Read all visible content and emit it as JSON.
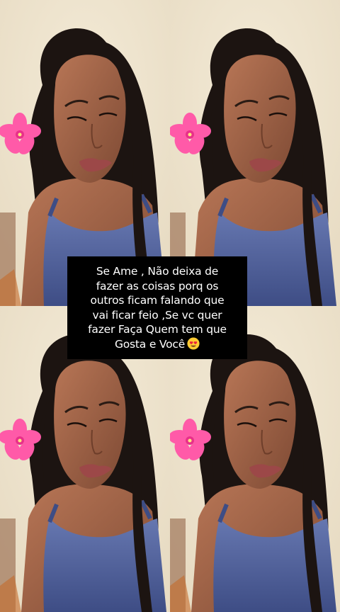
{
  "caption": {
    "lines": [
      "Se Ame , Não deixa de",
      "fazer as coisas porq os",
      "outros ficam falando que",
      "vai ficar feio ,Se vc quer",
      "fazer Faça Quem tem que",
      "Gosta e Você"
    ],
    "emoji": "heart-eyes-emoji"
  },
  "photo": {
    "tiles": 4,
    "description_icon": "selfie-photo",
    "colors": {
      "wall": "#e8dcc4",
      "hair": "#1c1411",
      "skin": "#a8684c",
      "top": "#5566a0",
      "flower": "#ff5aa8"
    }
  }
}
